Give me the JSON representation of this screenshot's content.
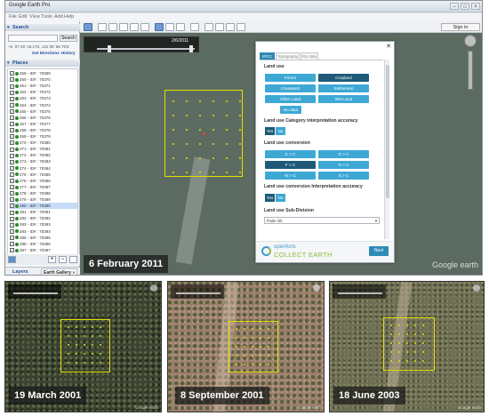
{
  "app": {
    "title": "Google Earth Pro"
  },
  "menu": [
    "File",
    "Edit",
    "View",
    "Tools",
    "Add",
    "Help"
  ],
  "toolbar": {
    "signin_label": "Sign in"
  },
  "search": {
    "header": "Search",
    "button": "Search",
    "coords_text": "-m: 07 25' 18.17S, 122 05' 58.75'E",
    "get_directions": "Get Directions",
    "history": "History"
  },
  "places": {
    "header": "Places",
    "items": [
      "259 - ID# : 70369",
      "260 - ID# : 70370",
      "261 - ID# : 70371",
      "262 - ID# : 70372",
      "263 - ID# : 70373",
      "264 - ID# : 70374",
      "265 - ID# : 70375",
      "266 - ID# : 70376",
      "267 - ID# : 70377",
      "268 - ID# : 70378",
      "269 - ID# : 70379",
      "270 - ID# : 70380",
      "271 - ID# : 70381",
      "272 - ID# : 70382",
      "273 - ID# : 70383",
      "274 - ID# : 70384",
      "275 - ID# : 70385",
      "276 - ID# : 70386",
      "277 - ID# : 70387",
      "278 - ID# : 70388",
      "279 - ID# : 70389",
      "280 - ID# : 70390",
      "281 - ID# : 70391",
      "282 - ID# : 70392",
      "283 - ID# : 70393",
      "284 - ID# : 70394",
      "285 - ID# : 70395",
      "286 - ID# : 70396",
      "287 - ID# : 70397"
    ],
    "selected_index": 21
  },
  "layers": {
    "header": "Layers",
    "gallery_tab": "Earth Gallery »"
  },
  "map": {
    "timebar_label": "2/6/2011",
    "date_label": "6 February 2011",
    "watermark": "Google earth"
  },
  "dialog": {
    "tabs": [
      "IPCC",
      "Topography",
      "RS data"
    ],
    "land_use_label": "Land use",
    "land_use_options": [
      "Forest",
      "Cropland",
      "Grassland",
      "Settlement",
      "Other Land",
      "Wet Land",
      "No data"
    ],
    "land_use_selected": "Cropland",
    "category_accuracy_label": "Land use Category interpretation accuracy",
    "yes": "Yes",
    "no": "No",
    "conversion_label": "Land use conversion",
    "conversion_options": [
      "C > C",
      "G > C",
      "F > C",
      "O > C",
      "W > C",
      "S > C"
    ],
    "conversion_selected": "F > C",
    "conversion_accuracy_label": "Land use conversion Interpretation accuracy",
    "subdivision_label": "Land use Sub-Division",
    "subdivision_value": "Palm Oil",
    "logo_line1": "openforis",
    "logo_line2": "COLLECT EARTH",
    "next_label": "Next"
  },
  "thumbnails": [
    {
      "date": "19 March 2001",
      "watermark": "Google earth"
    },
    {
      "date": "8 September 2001",
      "watermark": "Google earth"
    },
    {
      "date": "18 June 2003",
      "watermark": "Google earth"
    }
  ],
  "colors": {
    "accent": "#3ea8d5",
    "selected": "#1e5a78",
    "grid": "#e3e000",
    "logo_blue": "#3e9bd0",
    "logo_green": "#8dbb3a"
  }
}
